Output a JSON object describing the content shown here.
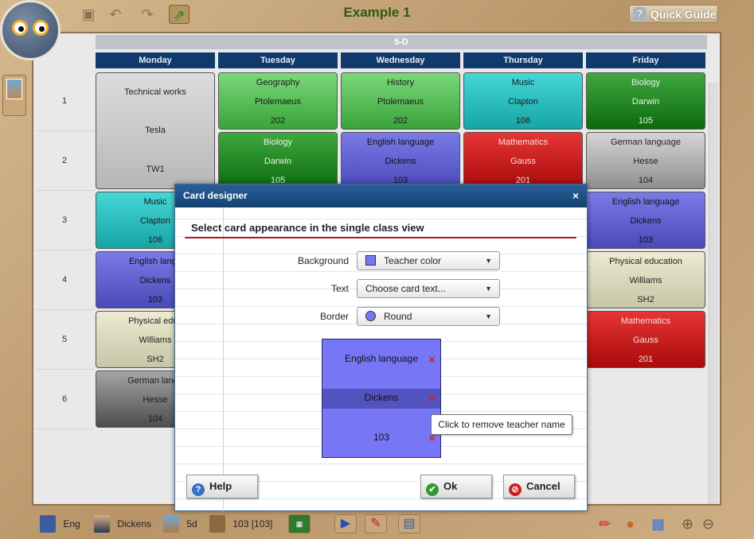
{
  "app": {
    "title": "Example 1",
    "quick_guide_label": "Quick Guide",
    "quick_guide_icon": "?"
  },
  "toolbar": {
    "icons": [
      "save-icon",
      "undo-icon",
      "redo-icon",
      "export-icon"
    ]
  },
  "timetable": {
    "class_name": "5-D",
    "days": [
      "Monday",
      "Tuesday",
      "Wednesday",
      "Thursday",
      "Friday"
    ],
    "periods": [
      "1",
      "2",
      "3",
      "4",
      "5",
      "6"
    ],
    "cards": {
      "mon_1": [
        "Technical works",
        "Tesla",
        "TW1"
      ],
      "tue_1": [
        "Geography",
        "Ptolemaeus",
        "202"
      ],
      "wed_1": [
        "History",
        "Ptolemaeus",
        "202"
      ],
      "thu_1": [
        "Music",
        "Clapton",
        "106"
      ],
      "fri_1": [
        "Biology",
        "Darwin",
        "105"
      ],
      "tue_2": [
        "Biology",
        "Darwin",
        "105"
      ],
      "wed_2": [
        "English language",
        "Dickens",
        "103"
      ],
      "thu_2": [
        "Mathematics",
        "Gauss",
        "201"
      ],
      "fri_2": [
        "German language",
        "Hesse",
        "104"
      ],
      "mon_3": [
        "Music",
        "Clapton",
        "106"
      ],
      "fri_3": [
        "English language",
        "Dickens",
        "103"
      ],
      "mon_4": [
        "English langu",
        "Dickens",
        "103"
      ],
      "fri_4": [
        "Physical education",
        "Williams",
        "SH2"
      ],
      "mon_5": [
        "Physical educ",
        "Williams",
        "SH2"
      ],
      "fri_5": [
        "Mathematics",
        "Gauss",
        "201"
      ],
      "mon_6": [
        "German langu",
        "Hesse",
        "104"
      ]
    }
  },
  "dialog": {
    "title": "Card designer",
    "close": "×",
    "heading": "Select card appearance in the single class view",
    "background_label": "Background",
    "background_value": "Teacher color",
    "text_label": "Text",
    "text_value": "Choose card text...",
    "border_label": "Border",
    "border_value": "Round",
    "preview": {
      "line1": "English language",
      "line2": "Dickens",
      "line3": "103",
      "remove_icon": "×"
    },
    "tooltip": "Click to remove teacher name",
    "help_label": "Help",
    "ok_label": "Ok",
    "cancel_label": "Cancel",
    "help_icon": "?",
    "ok_icon": "✔",
    "cancel_icon": "⊘"
  },
  "statusbar": {
    "language": "Eng",
    "teacher": "Dickens",
    "class": "5d",
    "room": "103 [103]"
  },
  "colors": {
    "header_blue": "#0f3a6b",
    "dialog_title": "#12416f",
    "title_green": "#2d5a10",
    "teacher_color": "#7777f5"
  }
}
